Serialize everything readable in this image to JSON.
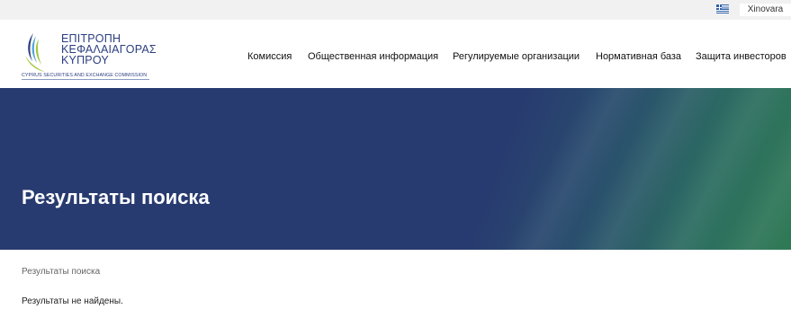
{
  "topbar": {
    "flag_icon": "greek-flag-icon",
    "user_label": "Xinovara"
  },
  "logo": {
    "line1": "ΕΠΙΤΡΟΠΗ",
    "line2": "ΚΕΦΑΛΑΙΑΓΟΡΑΣ",
    "line3": "ΚΥΠΡΟΥ",
    "subtitle": "CYPRUS SECURITIES AND EXCHANGE COMMISSION",
    "colors": {
      "navy": "#2b3e80",
      "green": "#a4c639",
      "blue": "#4fa3d9"
    }
  },
  "nav": {
    "items": [
      {
        "label": "Комиссия"
      },
      {
        "label": "Общественная информация"
      },
      {
        "label": "Регулируемые организации"
      },
      {
        "label": "Нормативная база"
      },
      {
        "label": "Защита инвесторов"
      }
    ]
  },
  "hero": {
    "title": "Результаты поиска",
    "colors": {
      "start": "#283b70",
      "end": "#2f7a55"
    }
  },
  "breadcrumb": {
    "current": "Результаты поиска"
  },
  "results": {
    "message": "Результаты не найдены."
  }
}
